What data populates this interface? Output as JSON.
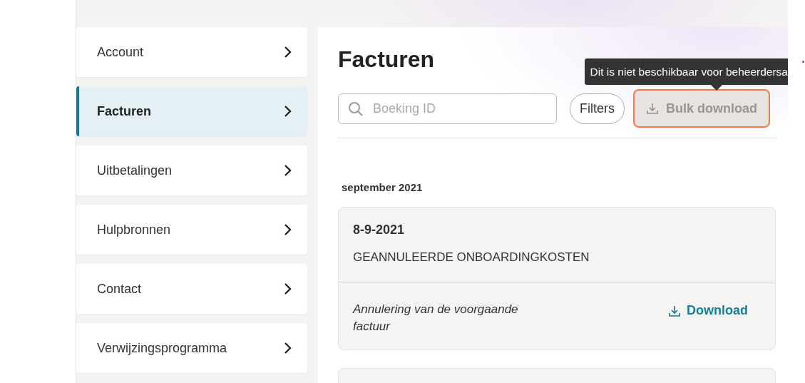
{
  "sidebar": {
    "items": [
      {
        "label": "Account",
        "selected": false
      },
      {
        "label": "Facturen",
        "selected": true
      },
      {
        "label": "Uitbetalingen",
        "selected": false
      },
      {
        "label": "Hulpbronnen",
        "selected": false
      },
      {
        "label": "Contact",
        "selected": false
      },
      {
        "label": "Verwijzingsprogramma",
        "selected": false
      }
    ]
  },
  "main": {
    "title": "Facturen",
    "search": {
      "placeholder": "Boeking ID"
    },
    "filters_button": "Filters",
    "bulk_download": {
      "label": "Bulk download",
      "disabled": true,
      "focused": true
    },
    "tooltip": "Dit is niet beschikbaar voor beheerdersa",
    "sections": [
      {
        "heading": "september 2021",
        "invoices": [
          {
            "date": "8-9-2021",
            "title": "GEANNULEERDE ONBOARDINGKOSTEN",
            "note": "Annulering van de voorgaande factuur",
            "action": "Download"
          }
        ],
        "next_card_partial": true
      }
    ]
  }
}
